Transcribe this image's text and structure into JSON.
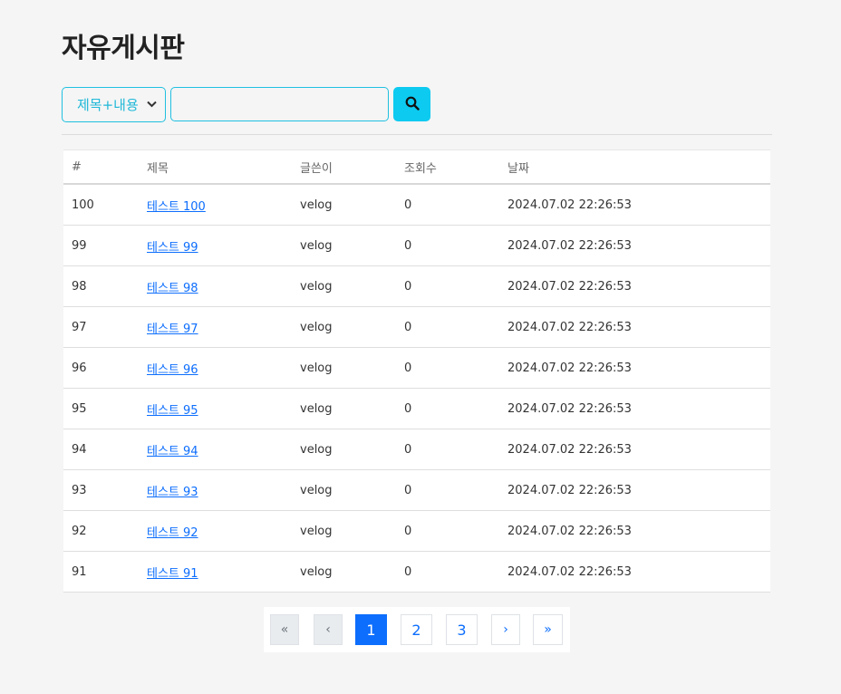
{
  "page": {
    "title": "자유게시판"
  },
  "search": {
    "select_value": "제목+내용",
    "input_value": "",
    "icon": "search-icon",
    "accent": "#0dcaf0"
  },
  "table": {
    "headers": [
      "#",
      "제목",
      "글쓴이",
      "조회수",
      "날짜"
    ],
    "rows": [
      {
        "num": "100",
        "title": "테스트 100",
        "author": "velog",
        "views": "0",
        "date": "2024.07.02 22:26:53"
      },
      {
        "num": "99",
        "title": "테스트 99",
        "author": "velog",
        "views": "0",
        "date": "2024.07.02 22:26:53"
      },
      {
        "num": "98",
        "title": "테스트 98",
        "author": "velog",
        "views": "0",
        "date": "2024.07.02 22:26:53"
      },
      {
        "num": "97",
        "title": "테스트 97",
        "author": "velog",
        "views": "0",
        "date": "2024.07.02 22:26:53"
      },
      {
        "num": "96",
        "title": "테스트 96",
        "author": "velog",
        "views": "0",
        "date": "2024.07.02 22:26:53"
      },
      {
        "num": "95",
        "title": "테스트 95",
        "author": "velog",
        "views": "0",
        "date": "2024.07.02 22:26:53"
      },
      {
        "num": "94",
        "title": "테스트 94",
        "author": "velog",
        "views": "0",
        "date": "2024.07.02 22:26:53"
      },
      {
        "num": "93",
        "title": "테스트 93",
        "author": "velog",
        "views": "0",
        "date": "2024.07.02 22:26:53"
      },
      {
        "num": "92",
        "title": "테스트 92",
        "author": "velog",
        "views": "0",
        "date": "2024.07.02 22:26:53"
      },
      {
        "num": "91",
        "title": "테스트 91",
        "author": "velog",
        "views": "0",
        "date": "2024.07.02 22:26:53"
      }
    ]
  },
  "pagination": {
    "first": "«",
    "prev": "‹",
    "pages": [
      "1",
      "2",
      "3"
    ],
    "current": "1",
    "next": "›",
    "last": "»"
  }
}
